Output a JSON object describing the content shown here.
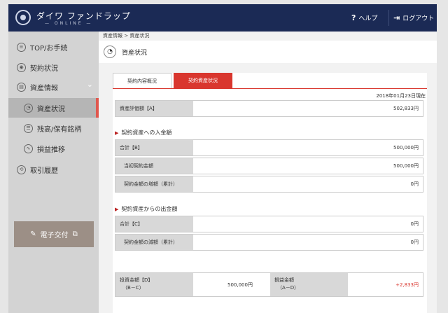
{
  "header": {
    "app_name": "ダイワ ファンドラップ",
    "app_sub": "— ONLINE —",
    "help_label": "ヘルプ",
    "logout_label": "ログアウト",
    "brand_color": "#1b2a55"
  },
  "sidebar": {
    "items": [
      {
        "label": "TOP/お手続",
        "icon": "list-icon"
      },
      {
        "label": "契約状況",
        "icon": "eye-icon"
      },
      {
        "label": "資産情報",
        "icon": "book-icon"
      },
      {
        "label": "資産状況",
        "icon": "pie-icon"
      },
      {
        "label": "残高/保有銘柄",
        "icon": "stack-icon"
      },
      {
        "label": "損益推移",
        "icon": "trend-icon"
      },
      {
        "label": "取引履歴",
        "icon": "history-icon"
      }
    ],
    "edoc_label": "電子交付"
  },
  "breadcrumb": "資産情報 > 資産状況",
  "page_title": "資産状況",
  "tabs": [
    "契約内容概況",
    "契約資産状況"
  ],
  "as_of": "2018年01月23日現在",
  "valuation": {
    "label": "資産評価額【A】",
    "value": "502,833円"
  },
  "deposit_section": {
    "title": "契約資産への入金額",
    "rows": [
      {
        "label": "合計【B】",
        "value": "500,000円"
      },
      {
        "label": "当初契約金額",
        "value": "500,000円"
      },
      {
        "label": "契約金額の増額（累計）",
        "value": "0円"
      }
    ]
  },
  "withdraw_section": {
    "title": "契約資産からの出金額",
    "rows": [
      {
        "label": "合計【C】",
        "value": "0円"
      },
      {
        "label": "契約金額の減額（累計）",
        "value": "0円"
      }
    ]
  },
  "summary": {
    "invest_label_1": "投資金額【D】",
    "invest_label_2": "（B－C）",
    "invest_value": "500,000円",
    "pl_label_1": "損益金額",
    "pl_label_2": "（A－D）",
    "pl_value": "+2,833円",
    "pl_color": "#d9362e"
  }
}
